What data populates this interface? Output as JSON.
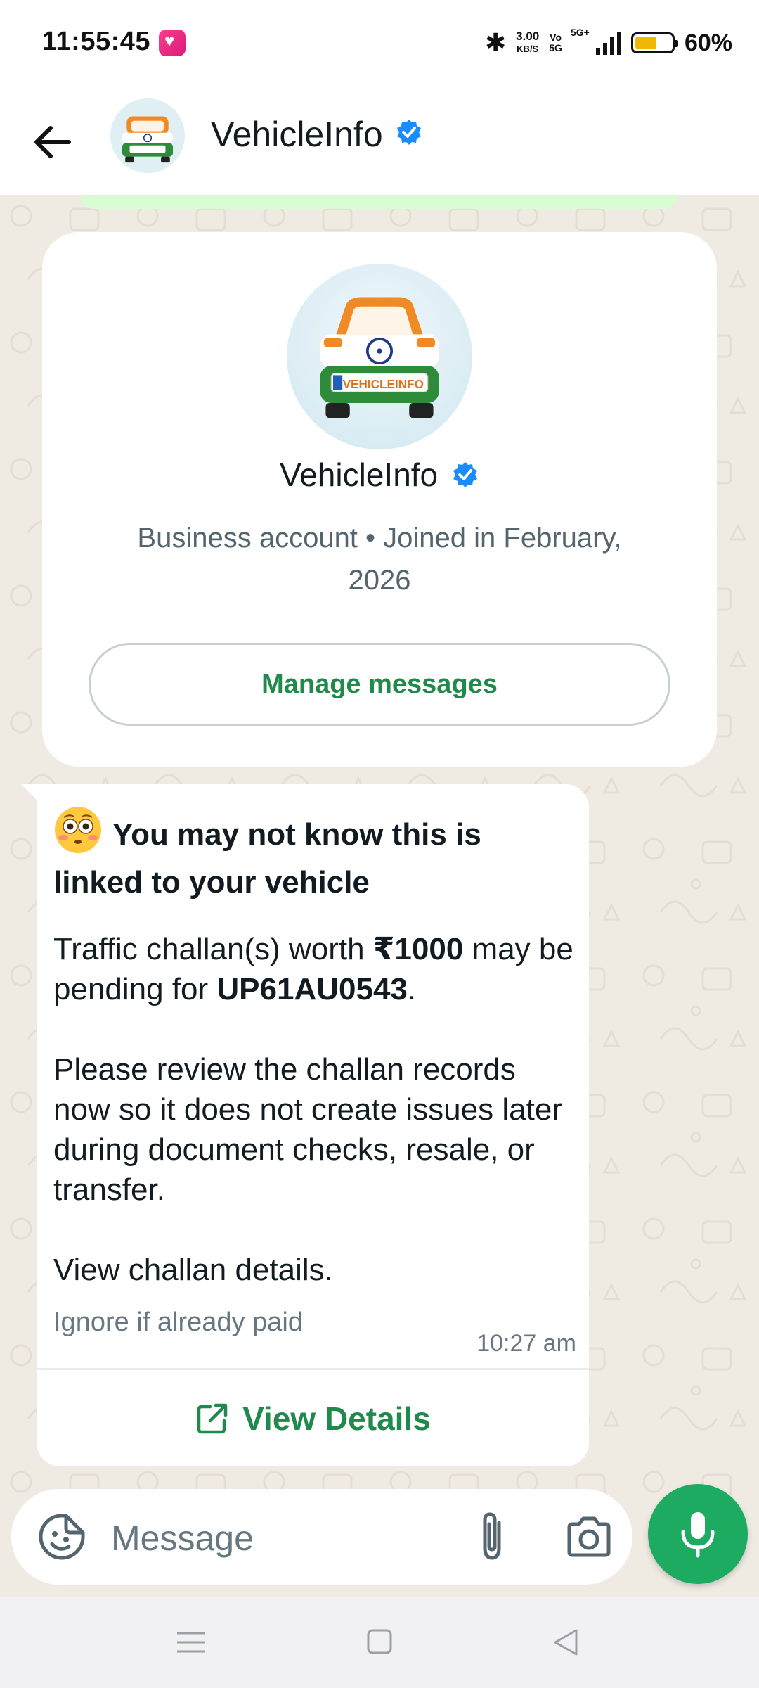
{
  "status_bar": {
    "time": "11:55:45",
    "net_speed_value": "3.00",
    "net_speed_unit": "KB/S",
    "volte_top": "Vo",
    "volte_bottom": "5G",
    "network_label": "5G+",
    "battery_percent_text": "60%",
    "battery_level": 0.6,
    "battery_color": "#f2b705"
  },
  "header": {
    "title": "VehicleInfo",
    "verified_icon": "verified-badge-icon",
    "back_icon": "arrow-left-icon",
    "menu_icon": "more-vertical-icon"
  },
  "profile_card": {
    "name": "VehicleInfo",
    "subtitle": "Business account • Joined in February, 2026",
    "manage_button": "Manage messages",
    "logo_text": "VEHICLEINFO"
  },
  "message": {
    "emoji": "flushed-face-emoji",
    "heading": "You may not know this is linked to your vehicle",
    "line1_prefix": "Traffic challan(s) worth ",
    "amount": "₹1000",
    "line1_mid": " may be pending for ",
    "vehicle_number": "UP61AU0543",
    "line1_suffix": ".",
    "paragraph2": "Please review the challan records now so it does not create issues later during document checks, resale, or transfer.",
    "paragraph3": "View challan details.",
    "footer": "Ignore if already paid",
    "time": "10:27 am",
    "action_button": "View Details",
    "action_icon": "open-external-icon"
  },
  "input_bar": {
    "placeholder": "Message",
    "sticker_icon": "sticker-icon",
    "attach_icon": "paperclip-icon",
    "camera_icon": "camera-icon",
    "mic_icon": "mic-icon"
  },
  "colors": {
    "accent_green": "#1f8a4c",
    "mic_green": "#1daa61",
    "chat_background": "#efeae2"
  }
}
